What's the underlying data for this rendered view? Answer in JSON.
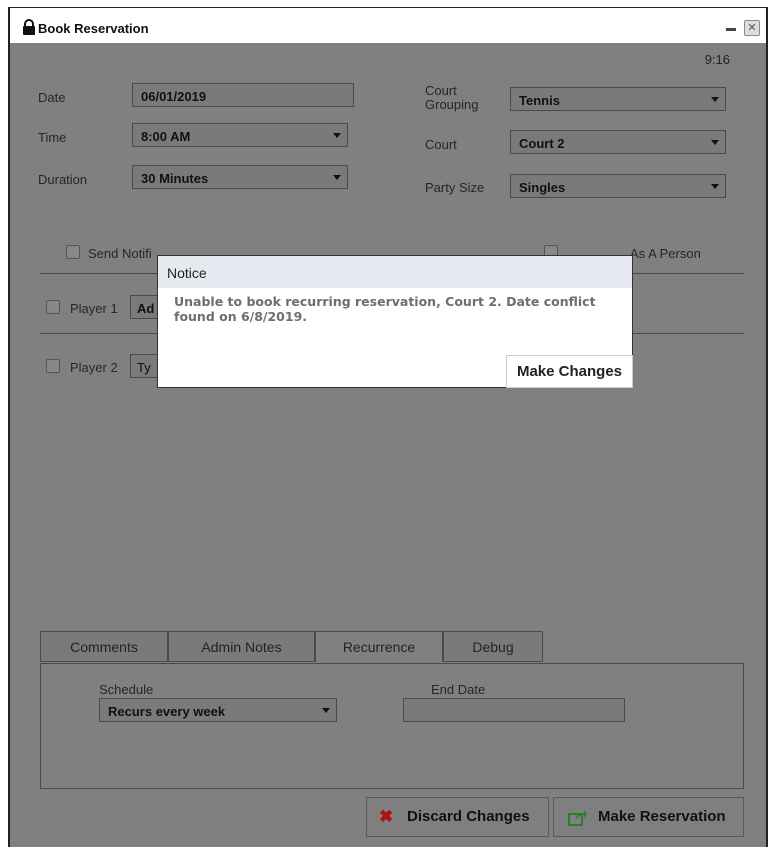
{
  "window": {
    "title": "Book Reservation",
    "close_glyph": "✕"
  },
  "clock": "9:16",
  "form": {
    "date_label": "Date",
    "date_value": "06/01/2019",
    "time_label": "Time",
    "time_value": "8:00 AM",
    "duration_label": "Duration",
    "duration_value": "30 Minutes",
    "court_grouping_label_1": "Court",
    "court_grouping_label_2": "Grouping",
    "court_grouping_value": "Tennis",
    "court_label": "Court",
    "court_value": "Court 2",
    "party_size_label": "Party Size",
    "party_size_value": "Singles",
    "send_notification_label": "Send Notifi",
    "as_person_label": "As A Person"
  },
  "players": [
    {
      "label": "Player 1",
      "value": "Ad"
    },
    {
      "label": "Player 2",
      "value": "Ty"
    }
  ],
  "tabs": [
    {
      "label": "Comments"
    },
    {
      "label": "Admin Notes"
    },
    {
      "label": "Recurrence"
    },
    {
      "label": "Debug"
    }
  ],
  "recurrence": {
    "schedule_label": "Schedule",
    "schedule_value": "Recurs every week",
    "end_date_label": "End Date",
    "end_date_value": ""
  },
  "buttons": {
    "discard": "Discard Changes",
    "make_reservation": "Make Reservation"
  },
  "dialog": {
    "title": "Notice",
    "message": "Unable to book recurring reservation, Court 2. Date conflict found on 6/8/2019.",
    "action": "Make Changes"
  },
  "colors": {
    "discard_icon": "#b01010",
    "reservation_icon": "#2f7d2a"
  }
}
